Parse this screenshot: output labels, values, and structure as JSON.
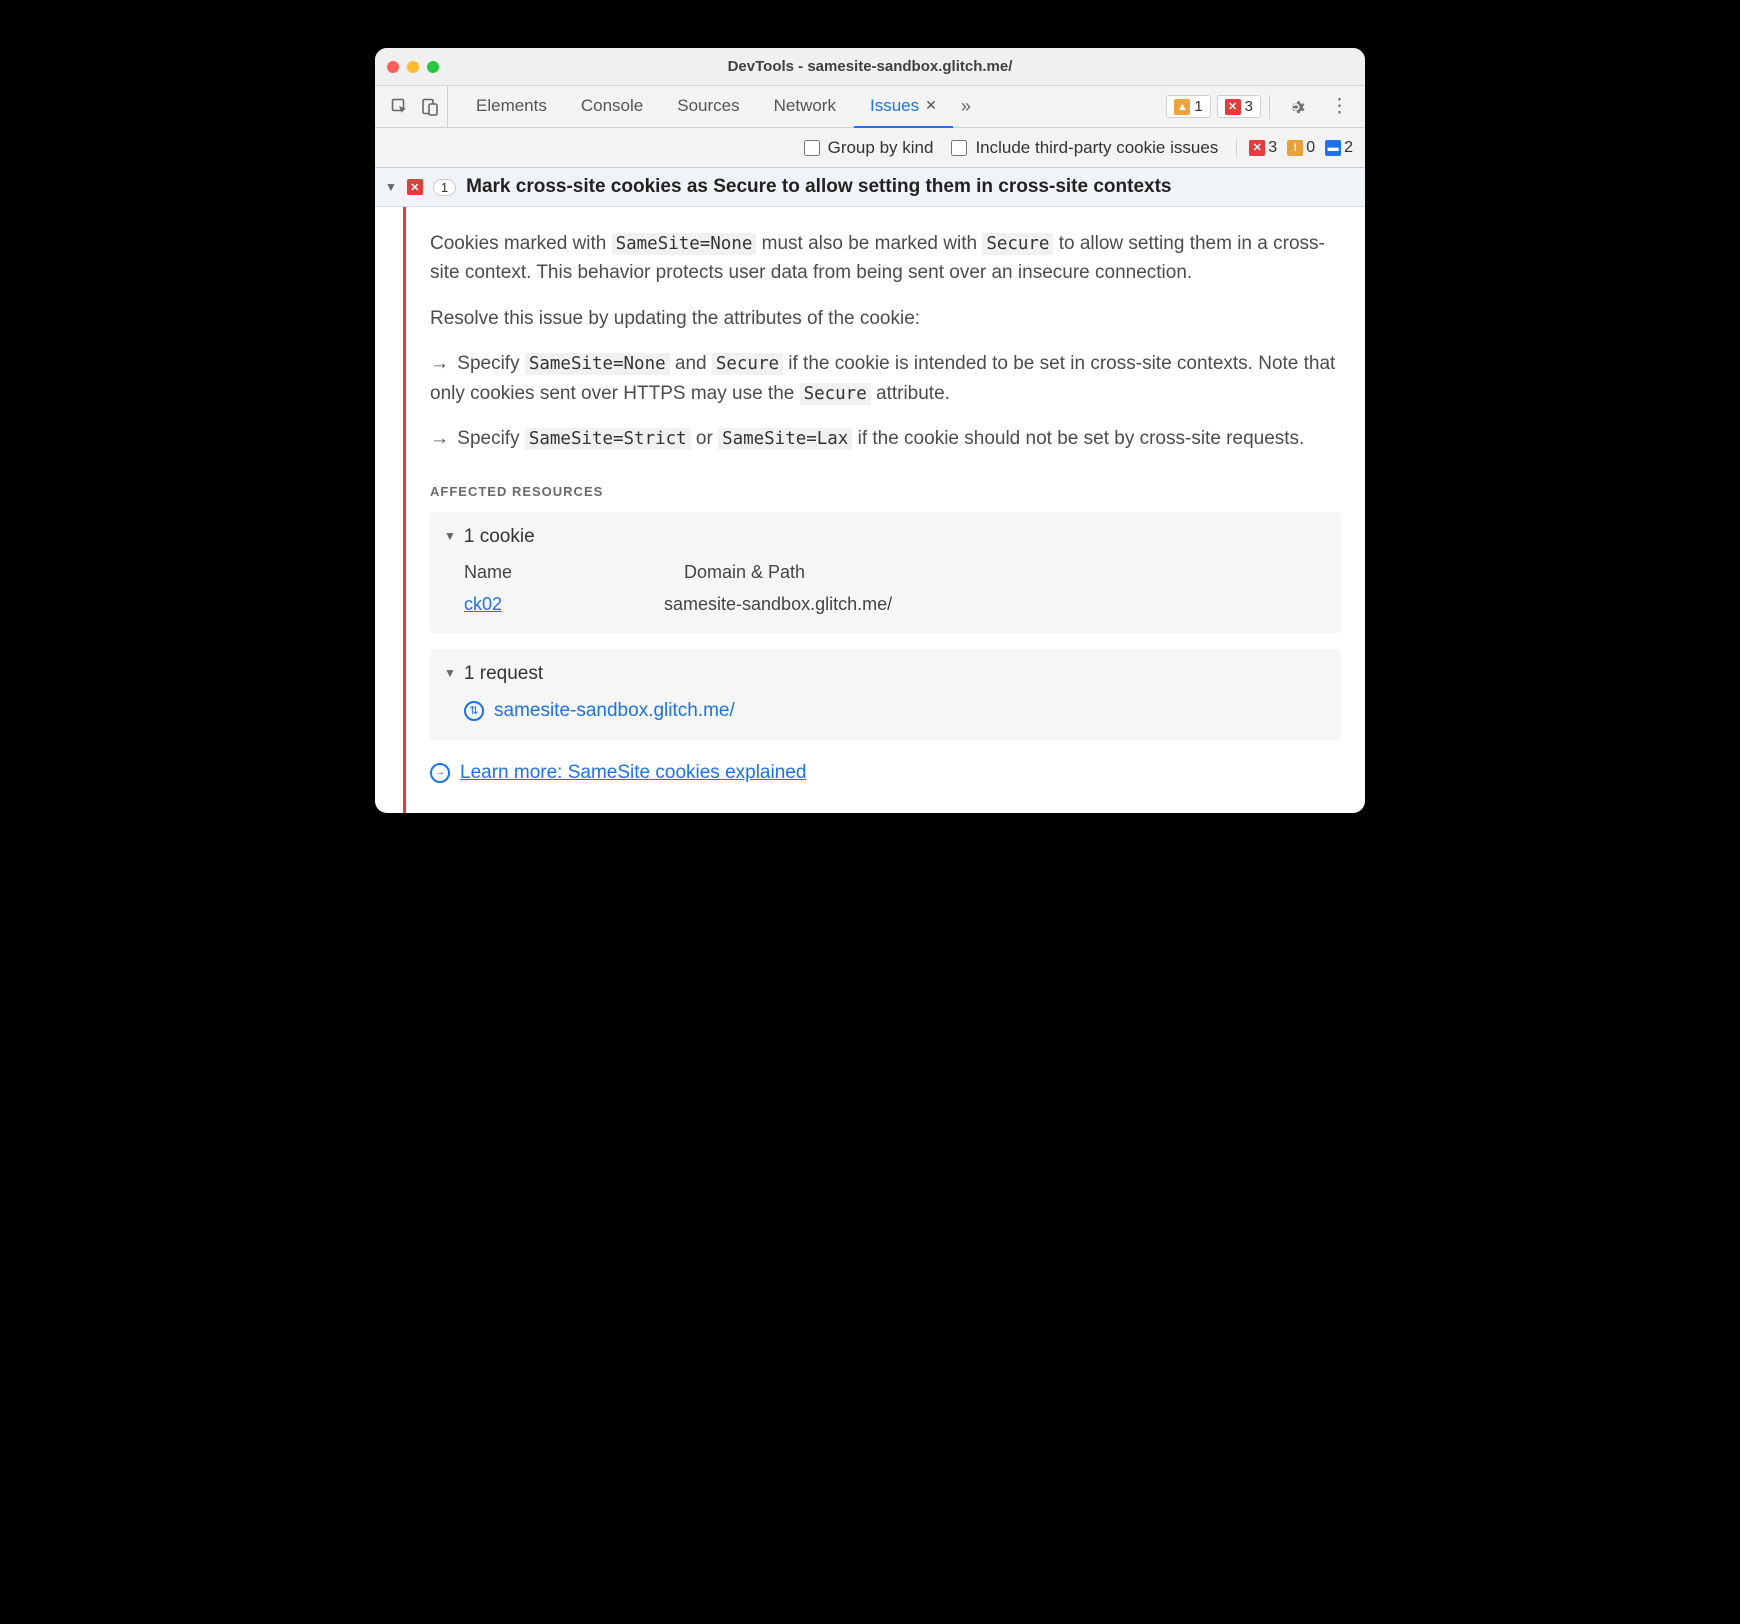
{
  "window": {
    "title": "DevTools - samesite-sandbox.glitch.me/"
  },
  "tabs": {
    "items": [
      "Elements",
      "Console",
      "Sources",
      "Network",
      "Issues"
    ],
    "active": 4
  },
  "toolbar_badges": {
    "warnings": "1",
    "errors": "3"
  },
  "filters": {
    "group_by_kind": "Group by kind",
    "include_third_party": "Include third-party cookie issues",
    "counts": {
      "errors": "3",
      "warnings": "0",
      "info": "2"
    }
  },
  "issue": {
    "count": "1",
    "title": "Mark cross-site cookies as Secure to allow setting them in cross-site contexts",
    "p1_pre": "Cookies marked with ",
    "p1_code1": "SameSite=None",
    "p1_mid": " must also be marked with ",
    "p1_code2": "Secure",
    "p1_post": " to allow setting them in a cross-site context. This behavior protects user data from being sent over an insecure connection.",
    "p2": "Resolve this issue by updating the attributes of the cookie:",
    "b1_pre": "Specify ",
    "b1_code1": "SameSite=None",
    "b1_mid": " and ",
    "b1_code2": "Secure",
    "b1_post1": " if the cookie is intended to be set in cross-site contexts. Note that only cookies sent over HTTPS may use the ",
    "b1_code3": "Secure",
    "b1_post2": " attribute.",
    "b2_pre": "Specify ",
    "b2_code1": "SameSite=Strict",
    "b2_mid": " or ",
    "b2_code2": "SameSite=Lax",
    "b2_post": " if the cookie should not be set by cross-site requests.",
    "affected_label": "AFFECTED RESOURCES",
    "cookie_block": {
      "header": "1 cookie",
      "col1": "Name",
      "col2": "Domain & Path",
      "name": "ck02",
      "domain": "samesite-sandbox.glitch.me/"
    },
    "request_block": {
      "header": "1 request",
      "url": "samesite-sandbox.glitch.me/"
    },
    "learn_more": "Learn more: SameSite cookies explained"
  }
}
